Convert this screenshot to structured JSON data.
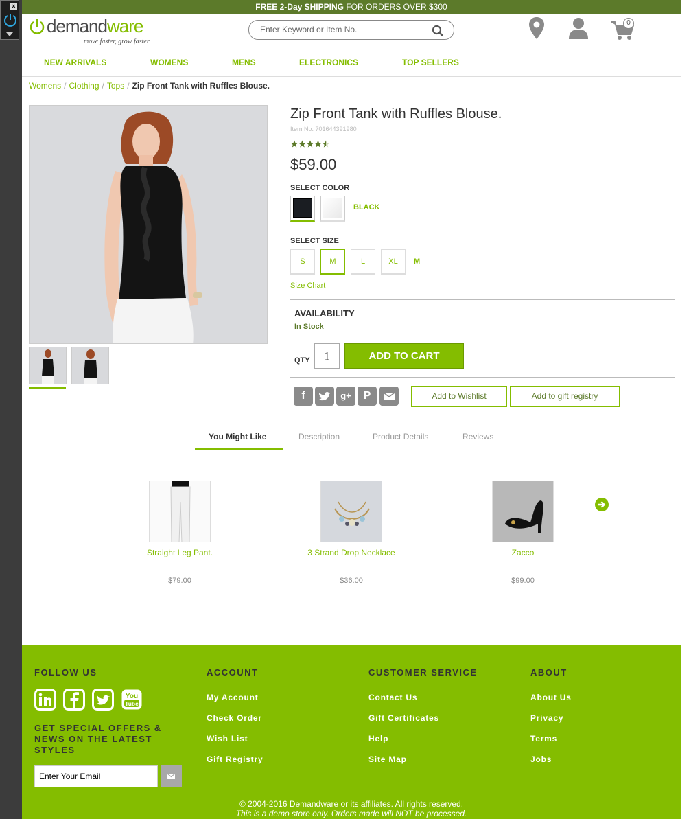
{
  "promo": {
    "bold": "FREE 2-Day SHIPPING",
    "rest": " FOR ORDERS OVER $300"
  },
  "logo": {
    "brand_part1": "demand",
    "brand_part2": "ware",
    "tagline": "move faster, grow faster"
  },
  "search": {
    "placeholder": "Enter Keyword or Item No."
  },
  "cart": {
    "count": "0"
  },
  "nav": [
    "NEW ARRIVALS",
    "WOMENS",
    "MENS",
    "ELECTRONICS",
    "TOP SELLERS"
  ],
  "breadcrumb": {
    "items": [
      "Womens",
      "Clothing",
      "Tops"
    ],
    "separator": "/",
    "current": "Zip Front Tank with Ruffles Blouse."
  },
  "product": {
    "title": "Zip Front Tank with Ruffles Blouse.",
    "item_no": "Item No. 701644391980",
    "rating": 4.5,
    "price": "$59.00",
    "select_color_label": "SELECT COLOR",
    "selected_color": "BLACK",
    "select_size_label": "SELECT SIZE",
    "sizes": [
      "S",
      "M",
      "L",
      "XL"
    ],
    "selected_size": "M",
    "size_chart": "Size Chart",
    "availability_label": "AVAILABILITY",
    "availability_status": "In Stock",
    "qty_label": "QTY",
    "qty_value": "1",
    "add_to_cart": "ADD TO CART",
    "add_to_wishlist": "Add to Wishlist",
    "add_to_registry": "Add to gift registry"
  },
  "tabs": [
    "You Might Like",
    "Description",
    "Product Details",
    "Reviews"
  ],
  "recommendations": [
    {
      "name": "Straight Leg Pant.",
      "price": "$79.00"
    },
    {
      "name": "3 Strand Drop Necklace",
      "price": "$36.00"
    },
    {
      "name": "Zacco",
      "price": "$99.00"
    }
  ],
  "footer": {
    "follow_us": "FOLLOW US",
    "offers": "GET SPECIAL OFFERS & NEWS ON THE LATEST STYLES",
    "email_placeholder": "Enter Your Email",
    "account_head": "ACCOUNT",
    "account_links": [
      "My Account",
      "Check Order",
      "Wish List",
      "Gift Registry"
    ],
    "cs_head": "CUSTOMER SERVICE",
    "cs_links": [
      "Contact Us",
      "Gift Certificates",
      "Help",
      "Site Map"
    ],
    "about_head": "ABOUT",
    "about_links": [
      "About Us",
      "Privacy",
      "Terms",
      "Jobs"
    ],
    "copyright": "© 2004-2016 Demandware or its affiliates. All rights reserved.",
    "demo_note": "This is a demo store only. Orders made will NOT be processed."
  },
  "colors": {
    "accent": "#84bd00",
    "banner": "#5c7a2a"
  }
}
